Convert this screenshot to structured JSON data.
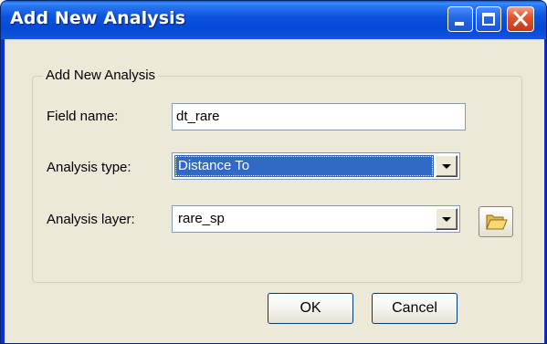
{
  "window": {
    "title": "Add New Analysis",
    "controls": {
      "minimize_icon": "minimize-icon",
      "maximize_icon": "maximize-icon",
      "close_icon": "close-icon"
    }
  },
  "group": {
    "legend": "Add New Analysis"
  },
  "fields": {
    "field_name": {
      "label": "Field name:",
      "value": "dt_rare"
    },
    "analysis_type": {
      "label": "Analysis type:",
      "value": "Distance To"
    },
    "analysis_layer": {
      "label": "Analysis layer:",
      "value": "rare_sp",
      "browse_icon": "folder-open-icon"
    }
  },
  "buttons": {
    "ok": "OK",
    "cancel": "Cancel"
  },
  "colors": {
    "titlebar": "#0a4fd8",
    "close_button": "#e0562e",
    "dialog_background": "#ece9d8",
    "selection_highlight": "#316ac5",
    "input_border": "#7f9db9"
  }
}
